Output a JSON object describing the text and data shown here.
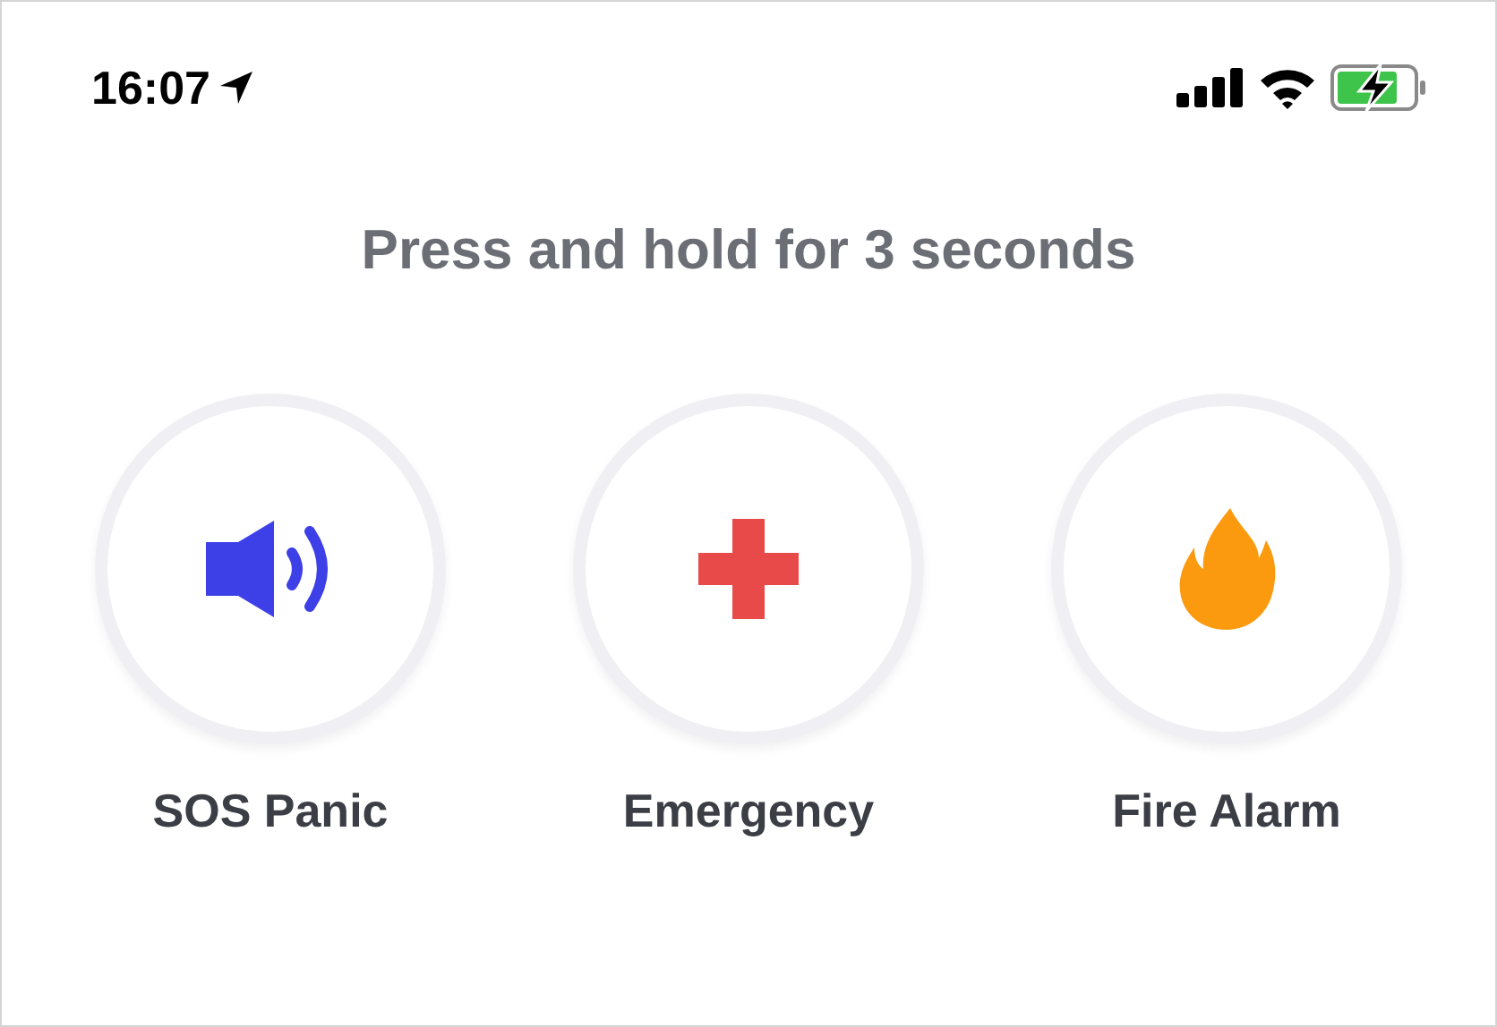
{
  "status_bar": {
    "time": "16:07"
  },
  "instruction": "Press and hold for 3 seconds",
  "actions": [
    {
      "kind": "speaker",
      "label": "SOS Panic",
      "color": "#3d40e6"
    },
    {
      "kind": "cross",
      "label": "Emergency",
      "color": "#e84a4a"
    },
    {
      "kind": "flame",
      "label": "Fire Alarm",
      "color": "#fb9a0e"
    }
  ]
}
